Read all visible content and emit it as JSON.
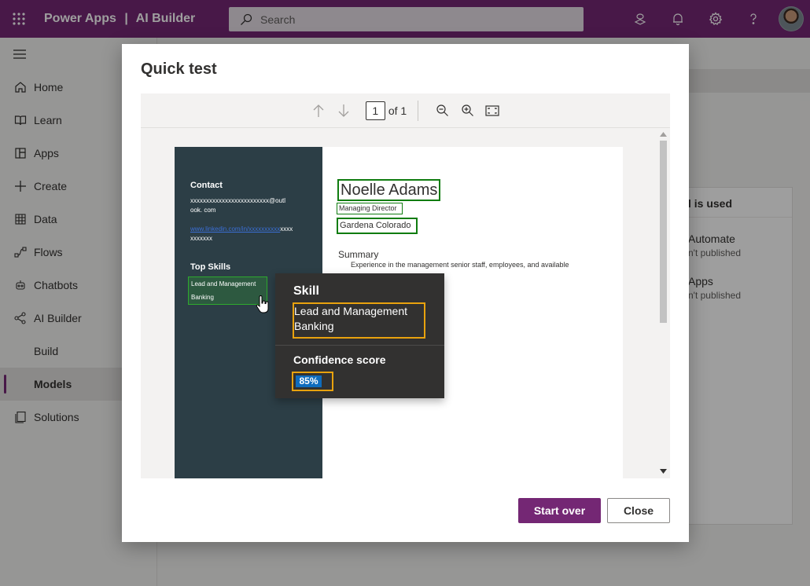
{
  "topbar": {
    "app_name": "Power Apps",
    "separator": "|",
    "product": "AI Builder",
    "search_placeholder": "Search"
  },
  "nav": {
    "items": [
      {
        "label": "Home",
        "icon": "home-icon"
      },
      {
        "label": "Learn",
        "icon": "book-icon"
      },
      {
        "label": "Apps",
        "icon": "apps-icon"
      },
      {
        "label": "Create",
        "icon": "plus-icon"
      },
      {
        "label": "Data",
        "icon": "table-icon"
      },
      {
        "label": "Flows",
        "icon": "flow-icon"
      },
      {
        "label": "Chatbots",
        "icon": "bot-icon"
      },
      {
        "label": "AI Builder",
        "icon": "ai-icon"
      },
      {
        "label": "Build",
        "icon": ""
      },
      {
        "label": "Models",
        "icon": ""
      },
      {
        "label": "Solutions",
        "icon": "solutions-icon"
      }
    ]
  },
  "background": {
    "card_title": "l is used",
    "rows": [
      {
        "title": "Automate",
        "sub": "n't published"
      },
      {
        "title": "Apps",
        "sub": "n't published"
      }
    ]
  },
  "dialog": {
    "title": "Quick test",
    "page_current": "1",
    "page_of": "of 1",
    "start_over": "Start over",
    "close": "Close"
  },
  "document": {
    "contact_label": "Contact",
    "email_line1": "xxxxxxxxxxxxxxxxxxxxxxxxx@outl",
    "email_line2": "ook. com",
    "linkedin_link": "www.linkedin.com/in/xxxxxxxxxx",
    "linkedin_tail1": "xxxx",
    "linkedin_tail2": "xxxxxxx",
    "top_skills_label": "Top Skills",
    "skill_1": "Lead and Management",
    "skill_2": "Banking",
    "name": "Noelle Adams",
    "title": "Managing Director",
    "location": "Gardena Colorado",
    "summary_label": "Summary",
    "summary_text": "Experience in the management senior staff, employees, and available"
  },
  "tooltip": {
    "heading": "Skill",
    "value_line1": "Lead and Management",
    "value_line2": "Banking",
    "confidence_label": "Confidence score",
    "confidence_value": "85%"
  },
  "colors": {
    "brand": "#742774",
    "doc_sidebar": "#2c3e46",
    "detected_box": "#107c10",
    "highlight": "#e8a20e",
    "badge": "#0f6cbd"
  }
}
